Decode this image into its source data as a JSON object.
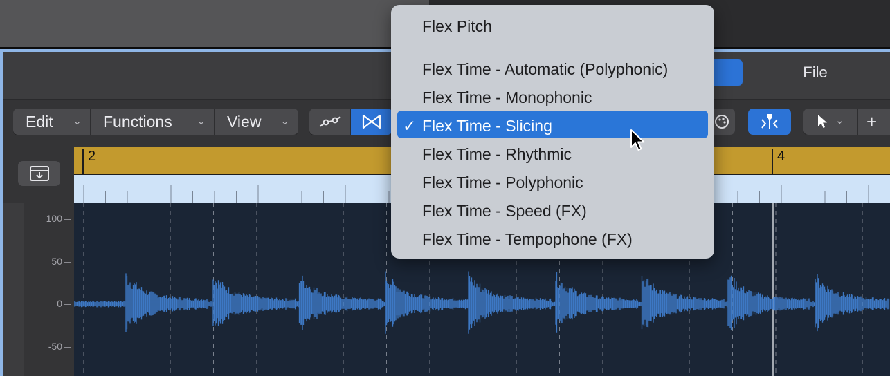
{
  "toolbar": {
    "edit": "Edit",
    "functions": "Functions",
    "view": "View"
  },
  "tabs": {
    "file": "File"
  },
  "ruler": {
    "bar_2": "2",
    "bar_4": "4"
  },
  "amplitude_scale": [
    "100",
    "50",
    "0",
    "-50"
  ],
  "flex_menu": {
    "header_item": "Flex Pitch",
    "items": [
      "Flex Time - Automatic (Polyphonic)",
      "Flex Time - Monophonic",
      "Flex Time - Slicing",
      "Flex Time - Rhythmic",
      "Flex Time - Polyphonic",
      "Flex Time - Speed (FX)",
      "Flex Time - Tempophone (FX)"
    ],
    "selected_index": 2,
    "checkmark": "✓"
  },
  "colors": {
    "accent_blue": "#2c73d6",
    "ruler_gold": "#c39a2e",
    "waveform": "#3d78c4",
    "wave_background": "#1a2535"
  }
}
